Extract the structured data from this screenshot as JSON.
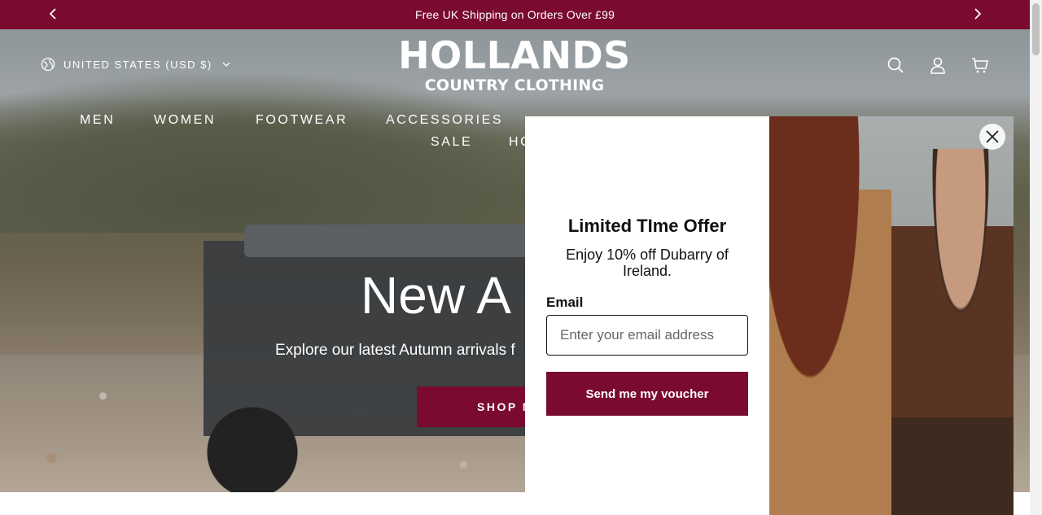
{
  "announcement": {
    "text": "Free UK Shipping on Orders Over £99",
    "prev_icon": "chevron-left-icon",
    "next_icon": "chevron-right-icon"
  },
  "header": {
    "locale_label": "UNITED STATES (USD $)",
    "logo_line1": "HOLLANDS",
    "logo_line2": "COUNTRY CLOTHING",
    "icons": [
      "search-icon",
      "account-icon",
      "cart-icon"
    ]
  },
  "nav": {
    "items": [
      "MEN",
      "WOMEN",
      "FOOTWEAR",
      "ACCESSORIES",
      "SALE",
      "HO"
    ]
  },
  "hero": {
    "title": "New A",
    "subtitle": "Explore our latest Autumn arrivals f",
    "button_label": "SHOP N"
  },
  "popup": {
    "title": "Limited TIme Offer",
    "description": "Enjoy 10% off Dubarry of Ireland.",
    "email_label": "Email",
    "email_placeholder": "Enter your email address",
    "email_value": "",
    "submit_label": "Send me my voucher",
    "close_icon": "close-icon"
  },
  "colors": {
    "brand": "#7a0a2f",
    "text": "#111111",
    "white": "#ffffff"
  }
}
